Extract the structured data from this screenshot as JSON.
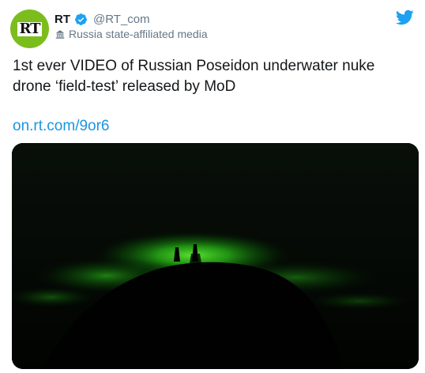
{
  "tweet": {
    "author": {
      "name": "RT",
      "handle": "@RT_com",
      "avatar_text": "RT",
      "verified": true,
      "label": "Russia state-affiliated media",
      "label_icon": "government-building-icon"
    },
    "text": "1st ever VIDEO of Russian Poseidon underwater nuke drone ‘field-test’ released by MoD",
    "link": "on.rt.com/9or6",
    "media": {
      "type": "video",
      "description_icon": "video-thumbnail"
    }
  },
  "colors": {
    "brand_blue": "#1da1f2",
    "link_blue": "#1b95e0",
    "avatar_green": "#7cbd1e",
    "secondary_text": "#657786",
    "primary_text": "#14171a"
  },
  "icons": {
    "verified": "verified-badge-icon",
    "platform": "twitter-bird-icon"
  }
}
